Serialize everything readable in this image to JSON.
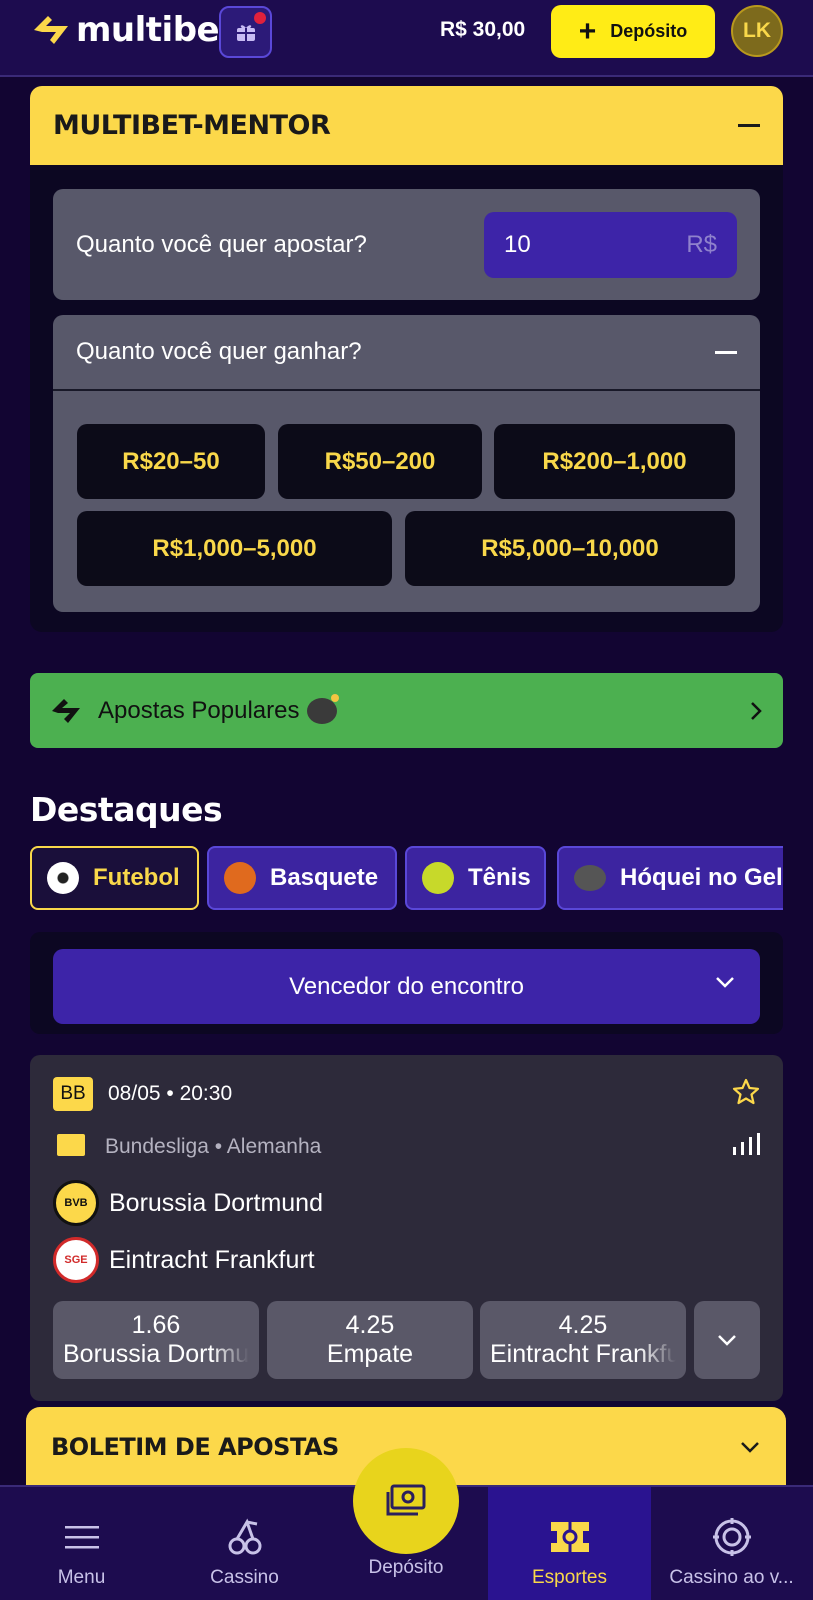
{
  "header": {
    "brand": "multibet",
    "balance": "R$ 30,00",
    "deposit_label": "Depósito",
    "avatar_initials": "LK"
  },
  "mentor": {
    "title": "MULTIBET-MENTOR",
    "bet_question": "Quanto você quer apostar?",
    "bet_value": "10",
    "bet_currency": "R$",
    "win_question": "Quanto você quer ganhar?",
    "ranges": [
      "R$20–50",
      "R$50–200",
      "R$200–1,000",
      "R$1,000–5,000",
      "R$5,000–10,000"
    ]
  },
  "popular": {
    "label": "Apostas Populares"
  },
  "highlights": {
    "title": "Destaques",
    "sports": [
      "Futebol",
      "Basquete",
      "Tênis",
      "Hóquei no Gelo"
    ],
    "active_sport": "Futebol",
    "market": "Vencedor do encontro"
  },
  "match": {
    "badge": "BB",
    "datetime": "08/05 • 20:30",
    "league": "Bundesliga • Alemanha",
    "home": "Borussia Dortmund",
    "away": "Eintracht Frankfurt",
    "odds": [
      {
        "value": "1.66",
        "label": "Borussia Dortmund"
      },
      {
        "value": "4.25",
        "label": "Empate"
      },
      {
        "value": "4.25",
        "label": "Eintracht Frankfurt"
      }
    ]
  },
  "betslip": {
    "title": "BOLETIM DE APOSTAS"
  },
  "bottom_nav": {
    "items": [
      "Menu",
      "Cassino",
      "Depósito",
      "Esportes",
      "Cassino ao v..."
    ],
    "active": "Esportes"
  },
  "colors": {
    "background": "#120532",
    "accent_yellow": "#fcd84a",
    "deposit_yellow": "#ffec16",
    "purple": "#3d24a8",
    "green": "#4cb050"
  }
}
